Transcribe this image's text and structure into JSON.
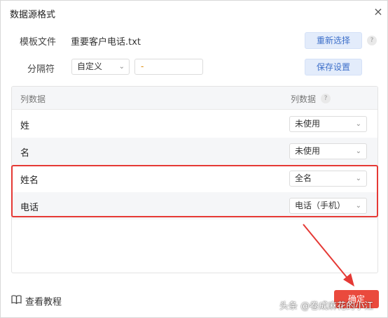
{
  "dialog": {
    "title": "数据源格式",
    "close_icon": "×"
  },
  "template_file": {
    "label": "模板文件",
    "file_name": "重要客户电话.txt",
    "reselect_label": "重新选择"
  },
  "separator": {
    "label": "分隔符",
    "select_value": "自定义",
    "input_value": "-",
    "save_label": "保存设置"
  },
  "help_icon_text": "?",
  "table": {
    "header_left": "列数据",
    "header_right": "列数据",
    "rows": [
      {
        "name": "姓",
        "mapping": "未使用"
      },
      {
        "name": "名",
        "mapping": "未使用"
      },
      {
        "name": "姓名",
        "mapping": "全名"
      },
      {
        "name": "电话",
        "mapping": "电话（手机）"
      }
    ]
  },
  "footer": {
    "tutorial_label": "查看教程",
    "ok_label": "确定"
  },
  "watermark": "头条 @卷成麻花的小江",
  "colors": {
    "accent": "#3d6fc9",
    "danger": "#ea4a3d",
    "highlight": "#e53935"
  },
  "icons": [
    "close-icon",
    "help-icon",
    "chevron-down-icon",
    "book-icon",
    "arrow-annotation"
  ]
}
